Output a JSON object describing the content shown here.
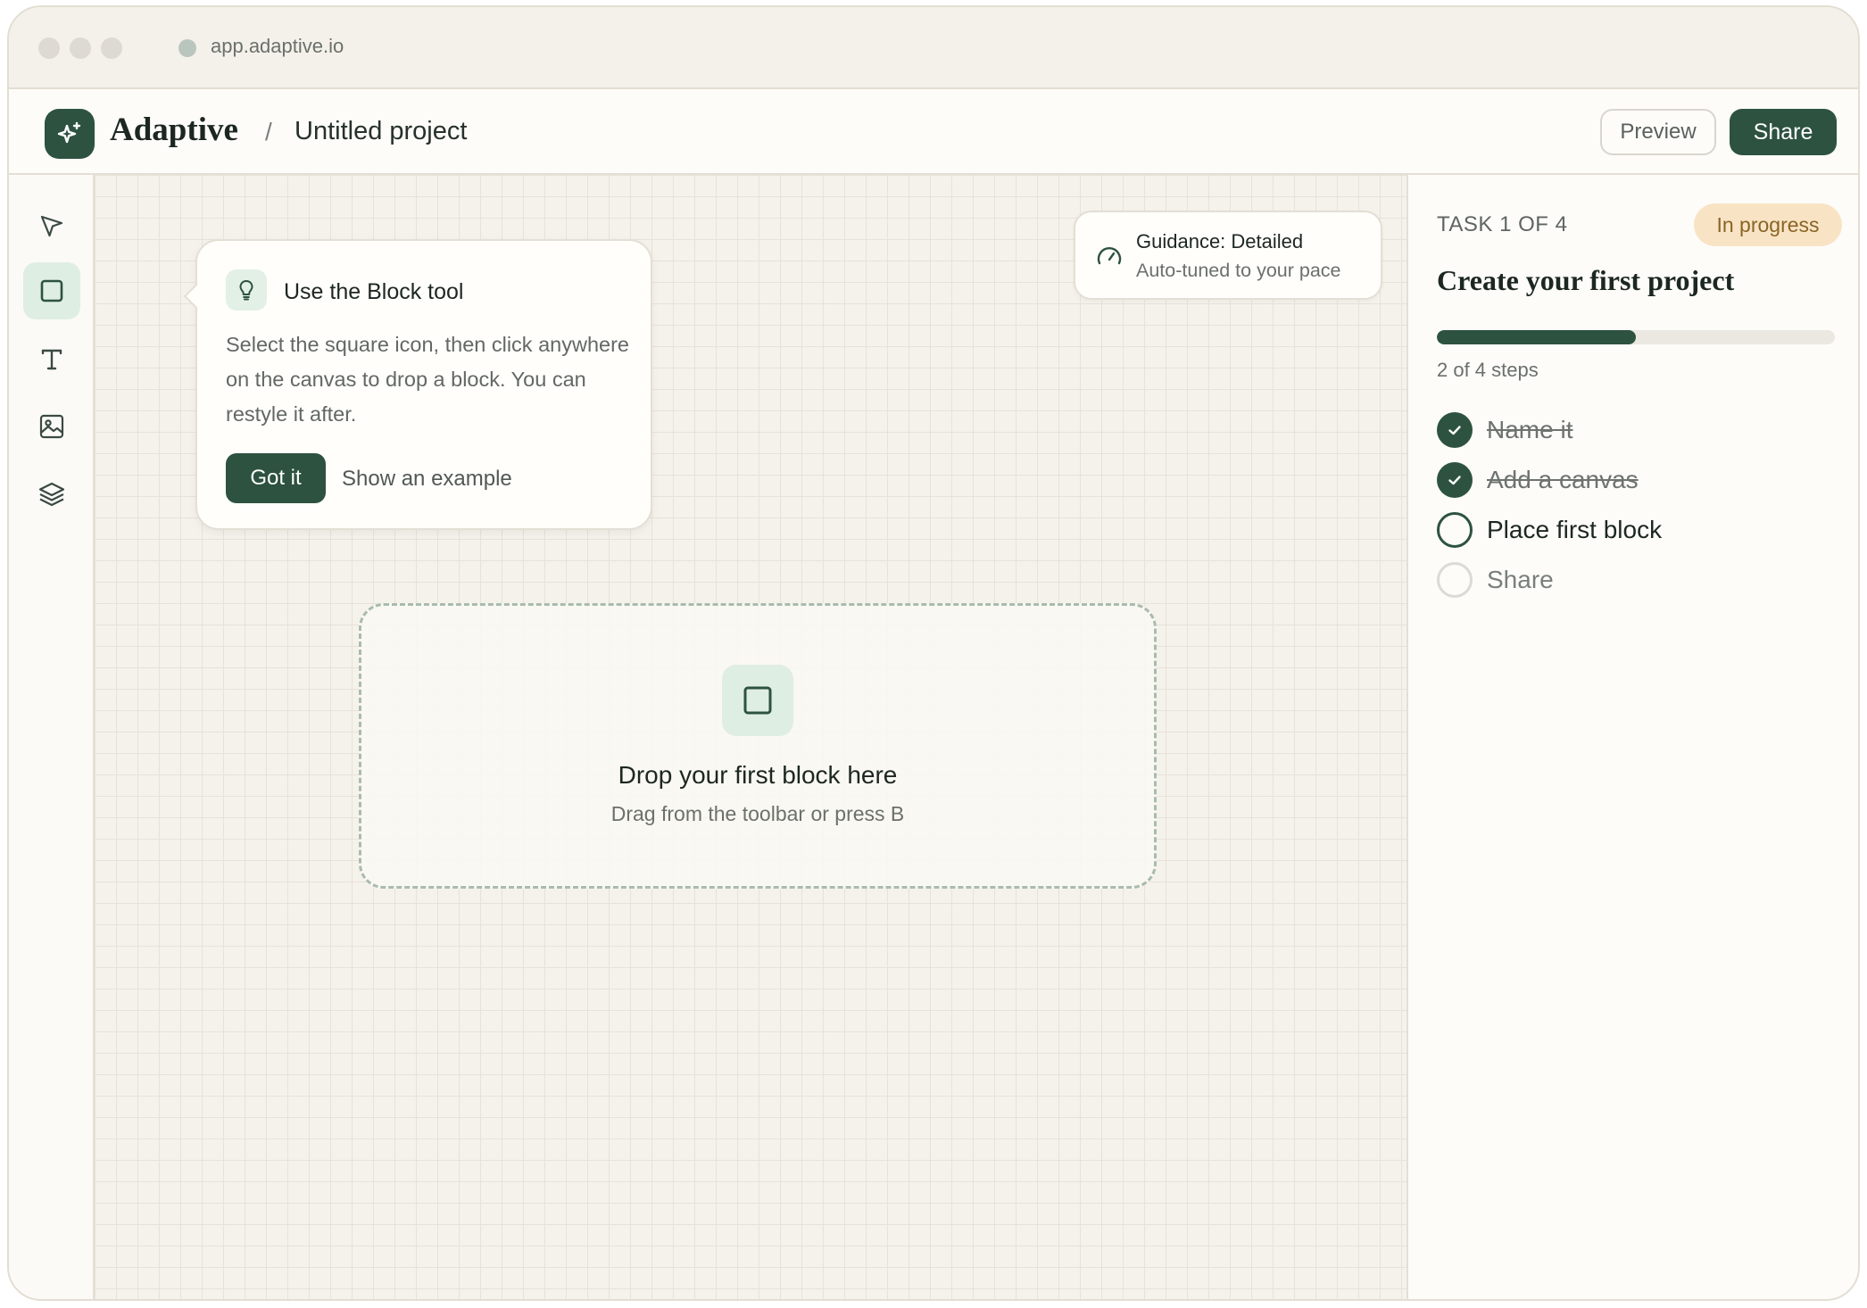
{
  "browser": {
    "url": "app.adaptive.io"
  },
  "header": {
    "brand": "Adaptive",
    "separator": "/",
    "project": "Untitled project",
    "preview_label": "Preview",
    "share_label": "Share"
  },
  "toolbar": {
    "tools": [
      {
        "name": "select",
        "icon": "cursor-arrow-icon",
        "active": false
      },
      {
        "name": "block",
        "icon": "square-icon",
        "active": true
      },
      {
        "name": "text",
        "icon": "text-icon",
        "active": false
      },
      {
        "name": "image",
        "icon": "image-icon",
        "active": false
      },
      {
        "name": "layers",
        "icon": "layers-icon",
        "active": false
      }
    ]
  },
  "tooltip": {
    "icon": "lightbulb-icon",
    "title": "Use the Block tool",
    "body": "Select the square icon, then click anywhere on the canvas to drop a block. You can restyle it after.",
    "primary_label": "Got it",
    "secondary_label": "Show an example"
  },
  "guidance": {
    "icon": "gauge-icon",
    "title": "Guidance: Detailed",
    "subtitle": "Auto-tuned to your pace"
  },
  "dropzone": {
    "icon": "square-icon",
    "title": "Drop your first block here",
    "subtitle": "Drag from the toolbar or press B"
  },
  "task_panel": {
    "label": "TASK 1 OF 4",
    "status": "In progress",
    "title": "Create your first project",
    "progress": 0.5,
    "steps_text": "2 of 4 steps",
    "steps": [
      {
        "label": "Name it",
        "state": "done"
      },
      {
        "label": "Add a canvas",
        "state": "done"
      },
      {
        "label": "Place first block",
        "state": "current"
      },
      {
        "label": "Share",
        "state": "todo"
      }
    ]
  },
  "colors": {
    "accent": "#2d5240",
    "accent_light": "#dfeee3",
    "badge_bg": "#f8e4c5",
    "badge_text": "#8a6425",
    "canvas_bg": "#f5f2eb"
  }
}
